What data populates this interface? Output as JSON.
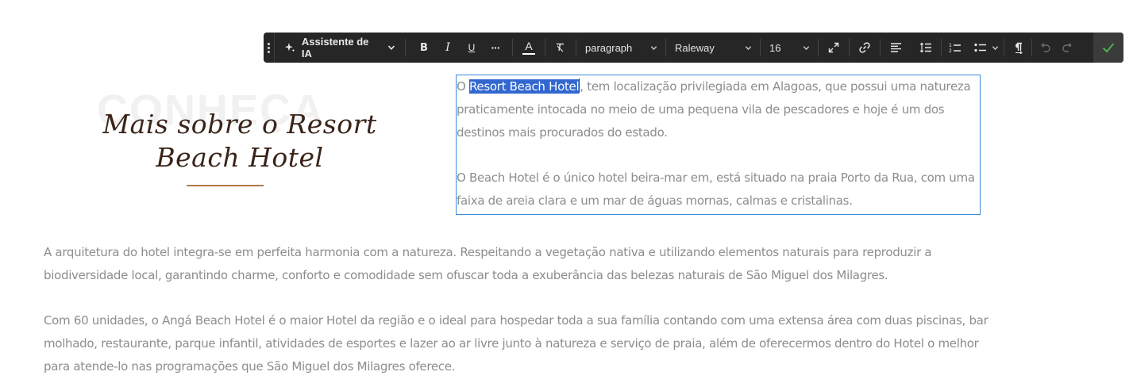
{
  "toolbar": {
    "ai_assistant_label": "Assistente de IA",
    "bold_label": "B",
    "italic_label": "I",
    "underline_label": "U",
    "more_label": "···",
    "text_color_label": "A",
    "block_format": "paragraph",
    "font_family": "Raleway",
    "font_size": "16",
    "icons": [
      "drag-handle-icon",
      "sparkle-icon",
      "chevron-down-icon",
      "clear-format-icon",
      "expand-icon",
      "link-icon",
      "align-left-icon",
      "line-height-icon",
      "ordered-list-icon",
      "bullet-list-icon",
      "paragraph-mark-icon",
      "undo-icon",
      "redo-icon",
      "check-icon"
    ]
  },
  "left_panel": {
    "background_word": "CONHEÇA",
    "script_title_line1": "Mais sobre o Resort",
    "script_title_line2": "Beach Hotel"
  },
  "content": {
    "p1_before": "O ",
    "p1_selected": "Resort Beach Hotel",
    "p1_after": ", tem localização privilegiada em Alagoas, que possui uma natureza praticamente intocada no meio de uma pequena vila de pescadores e hoje é um dos destinos mais procurados do estado.",
    "p2": "O Beach Hotel é o único hotel beira-mar em, está situado na praia Porto da Rua, com uma faixa de areia clara e um mar de águas mornas, calmas e cristalinas.",
    "p3": "A arquitetura do hotel integra-se em perfeita harmonia com a natureza. Respeitando a vegetação nativa e utilizando elementos naturais para reproduzir a biodiversidade local, garantindo charme, conforto e comodidade sem ofuscar toda a exuberância das belezas naturais de São Miguel dos Milagres.",
    "p4": "Com 60 unidades, o Angá Beach Hotel é o maior Hotel da região e o ideal para hospedar toda a sua família contando com  uma extensa área com duas piscinas, bar molhado, restaurante, parque infantil, atividades de esportes e lazer ao ar livre junto à natureza e serviço de praia, além de oferecermos dentro do Hotel o melhor para atende-lo nas programações que São Miguel dos Milagres oferece."
  },
  "colors": {
    "toolbar_bg": "#262626",
    "selection_bg": "#3167cf",
    "editbox_border": "#3b8ad9",
    "confirm_check": "#4caf50",
    "script_title": "#3a2419",
    "script_underline": "#b37a4a",
    "body_text": "#8d8d8d"
  }
}
